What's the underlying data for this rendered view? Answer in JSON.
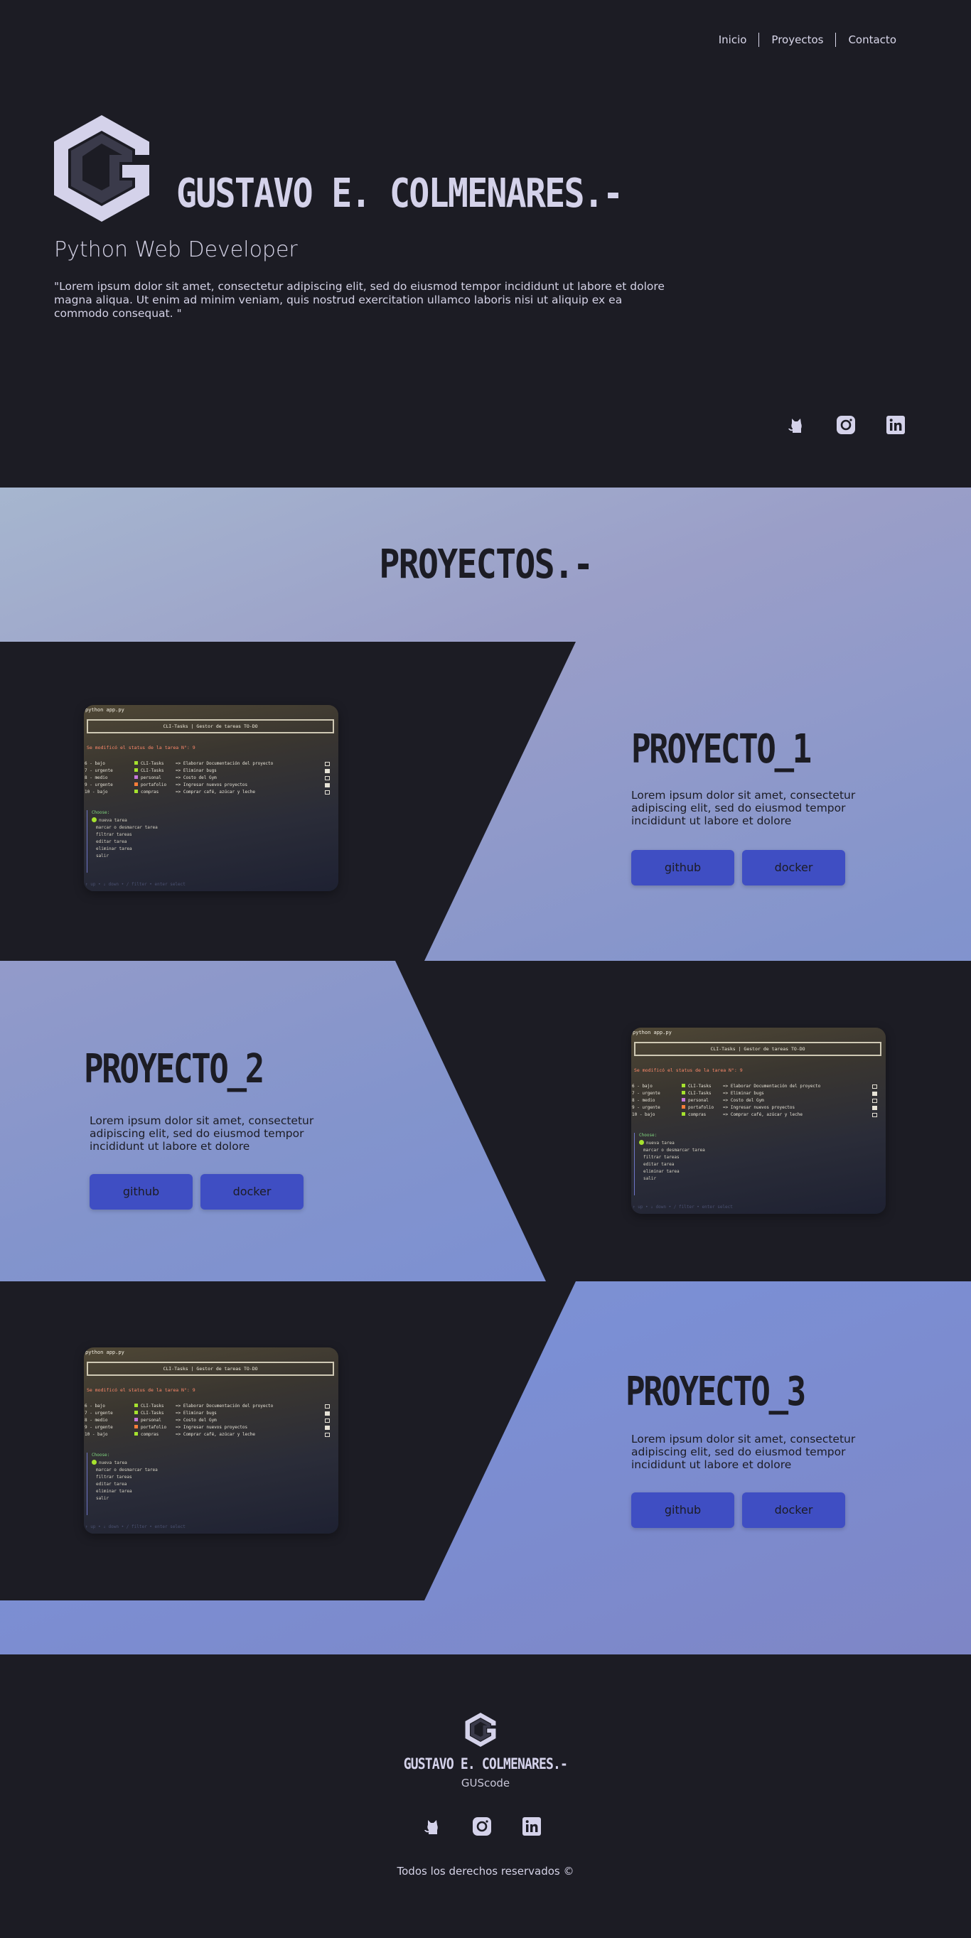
{
  "nav": {
    "items": [
      "Inicio",
      "Proyectos",
      "Contacto"
    ]
  },
  "hero": {
    "name": "GUSTAVO E. COLMENARES.-",
    "role": "Python Web Developer",
    "description": "\"Lorem ipsum dolor sit amet, consectetur adipiscing elit, sed do eiusmod tempor incididunt ut labore et dolore magna aliqua. Ut enim ad minim veniam, quis nostrud exercitation ullamco laboris nisi ut aliquip ex ea commodo consequat.  \"",
    "social_icons": [
      "github-icon",
      "instagram-icon",
      "linkedin-icon"
    ]
  },
  "projects": {
    "title": "PROYECTOS.-",
    "items": [
      {
        "title": "PROYECTO_1",
        "description": "Lorem ipsum dolor sit amet, consectetur adipiscing elit, sed do eiusmod tempor incididunt ut labore et dolore",
        "github_label": "github",
        "docker_label": "docker"
      },
      {
        "title": "PROYECTO_2",
        "description": "Lorem ipsum dolor sit amet, consectetur adipiscing elit, sed do eiusmod tempor incididunt ut labore et dolore",
        "github_label": "github",
        "docker_label": "docker"
      },
      {
        "title": "PROYECTO_3",
        "description": "Lorem ipsum dolor sit amet, consectetur adipiscing elit, sed do eiusmod tempor incididunt ut labore et dolore",
        "github_label": "github",
        "docker_label": "docker"
      }
    ]
  },
  "screenshot": {
    "command": "python app.py",
    "header": "CLI-Tasks | Gestor de tareas TO-DO",
    "warning": "Se modificó el status de la tarea N°: 9",
    "rows": [
      {
        "id": "6",
        "prio": "- bajo",
        "cat": "CLI-Tasks",
        "cat_color": "#a6e22e",
        "task": "=> Elaborar Documentación del proyecto",
        "done": false
      },
      {
        "id": "7",
        "prio": "- urgente",
        "cat": "CLI-Tasks",
        "cat_color": "#a6e22e",
        "task": "=> Eliminar bugs",
        "done": true
      },
      {
        "id": "8",
        "prio": "- medio",
        "cat": "personal",
        "cat_color": "#c678dd",
        "task": "=> Costo del Gym",
        "done": false
      },
      {
        "id": "9",
        "prio": "- urgente",
        "cat": "portafolio",
        "cat_color": "#fd7e3a",
        "task": "=> Ingresar nuevos proyectos",
        "done": true
      },
      {
        "id": "10",
        "prio": "- bajo",
        "cat": "compras",
        "cat_color": "#a6e22e",
        "task": "=> Comprar café, azúcar y leche",
        "done": false
      }
    ],
    "menu_header": "Choose:",
    "menu": [
      "nueva tarea",
      "marcar o desmarcar tarea",
      "filtrar tareas",
      "editar tarea",
      "eliminar tarea",
      "salir"
    ],
    "footer": "↑ up • ↓ down • / filter • enter select"
  },
  "footer": {
    "name": "GUSTAVO E. COLMENARES.-",
    "username": "GUScode",
    "rights": "Todos los derechos reservados ©",
    "social_icons": [
      "github-icon",
      "instagram-icon",
      "linkedin-icon"
    ]
  },
  "colors": {
    "dark": "#1c1c24",
    "text": "#d4d2e6",
    "button": "#3f4ec3"
  }
}
